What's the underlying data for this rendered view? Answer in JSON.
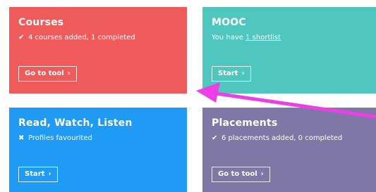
{
  "colors": {
    "courses_bg": "#ef5b5b",
    "mooc_bg": "#4fc7bf",
    "rwl_bg": "#1f9bf5",
    "placements_bg": "#7f78a6",
    "arrow": "#ee3ee6"
  },
  "tiles": {
    "courses": {
      "title": "Courses",
      "status_icon": "check-icon",
      "status_text": "4 courses added, 1 completed",
      "button_label": "Go to tool"
    },
    "mooc": {
      "title": "MOOC",
      "status_prefix": "You have ",
      "status_link": "1 shortlist",
      "button_label": "Start"
    },
    "rwl": {
      "title": "Read, Watch, Listen",
      "status_icon": "cross-icon",
      "status_text": "Profiles favourited",
      "button_label": "Start"
    },
    "placements": {
      "title": "Placements",
      "status_icon": "check-icon",
      "status_text": "6 placements added, 0 completed",
      "button_label": "Go to tool"
    }
  },
  "glyphs": {
    "check": "✔",
    "cross": "✖",
    "chevron": "›"
  }
}
